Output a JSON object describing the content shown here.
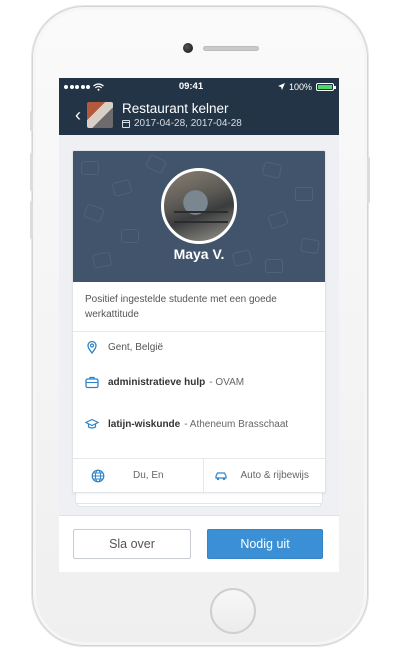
{
  "status_bar": {
    "time": "09:41",
    "battery": "100%",
    "battery_level": 1.0,
    "icons": [
      "signal-dots-icon",
      "wifi-icon",
      "location-arrow-icon",
      "battery-icon"
    ]
  },
  "nav": {
    "title": "Restaurant kelner",
    "dates": "2017-04-28, 2017-04-28",
    "icons": [
      "chevron-left-icon",
      "calendar-icon"
    ]
  },
  "profile": {
    "name": "Maya V.",
    "bio": "Positief ingestelde studente met een goede werkattitude",
    "location": "Gent, België",
    "experience": {
      "title": "administratieve hulp",
      "org": "- OVAM"
    },
    "education": {
      "title": "latijn-wiskunde",
      "org": "- Atheneum Brasschaat"
    },
    "languages": "Du, En",
    "transport": "Auto & rijbewijs"
  },
  "actions": {
    "skip_label": "Sla over",
    "invite_label": "Nodig uit"
  },
  "colors": {
    "navbar": "#243447",
    "hero": "#42546b",
    "accent": "#3b8fd4",
    "icon_blue": "#2f84c8"
  }
}
